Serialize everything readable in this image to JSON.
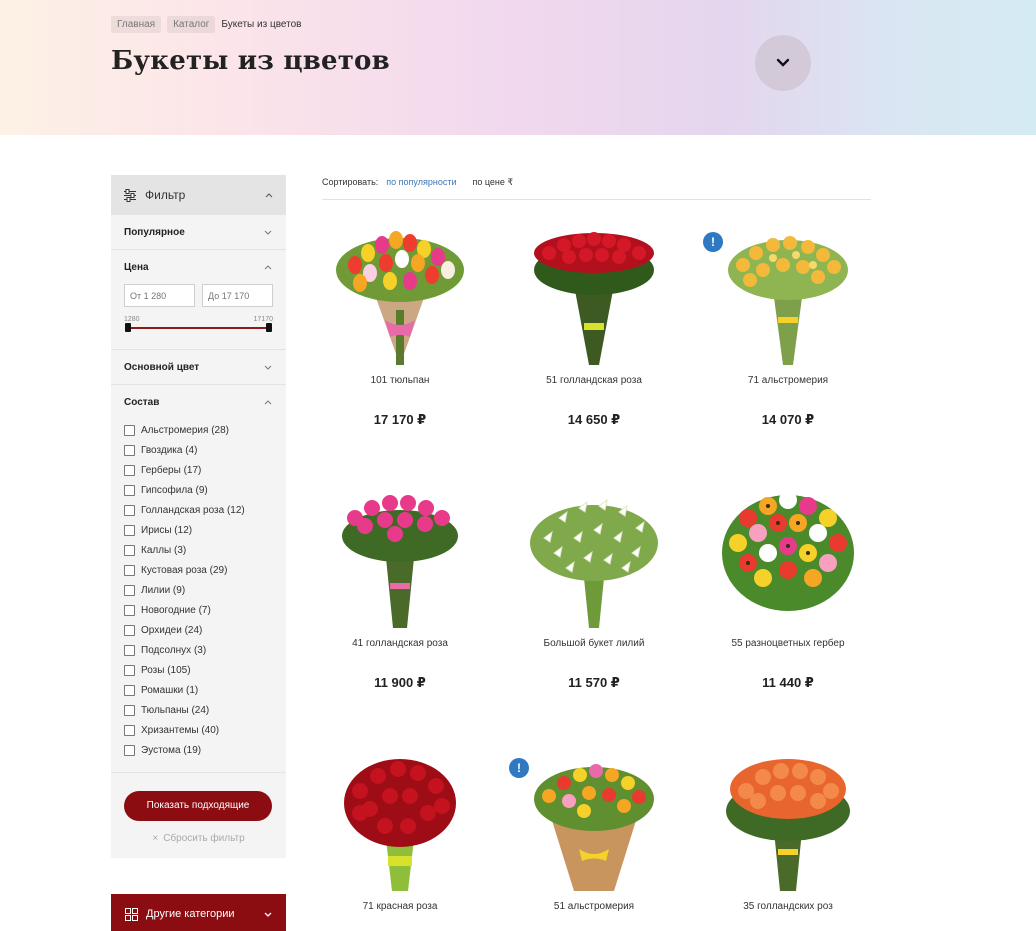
{
  "breadcrumb": [
    "Главная",
    "Каталог",
    "Букеты из цветов"
  ],
  "page_title": "Букеты из цветов",
  "sort": {
    "label": "Сортировать:",
    "popular": "по популярности",
    "price": "по цене ₹"
  },
  "filter": {
    "title": "Фильтр",
    "sections": {
      "popular": "Популярное",
      "price": "Цена",
      "color": "Основной цвет",
      "composition": "Состав"
    },
    "price_from": "От 1 280",
    "price_to": "До 17 170",
    "range_min": "1280",
    "range_max": "17170",
    "composition_items": [
      "Альстромерия (28)",
      "Гвоздика (4)",
      "Герберы (17)",
      "Гипсофила (9)",
      "Голландская роза (12)",
      "Ирисы (12)",
      "Каллы (3)",
      "Кустовая роза (29)",
      "Лилии (9)",
      "Новогодние (7)",
      "Орхидеи (24)",
      "Подсолнух (3)",
      "Розы (105)",
      "Ромашки (1)",
      "Тюльпаны (24)",
      "Хризантемы (40)",
      "Эустома (19)"
    ],
    "show_button": "Показать подходящие",
    "reset": "Сбросить фильтр"
  },
  "other_categories": "Другие категории",
  "products": [
    {
      "name": "101 тюльпан",
      "price": "17 170 ₽",
      "badge": ""
    },
    {
      "name": "51 голландская роза",
      "price": "14 650 ₽",
      "badge": ""
    },
    {
      "name": "71 альстромерия",
      "price": "14 070 ₽",
      "badge": "!"
    },
    {
      "name": "41 голландская роза",
      "price": "11 900 ₽",
      "badge": ""
    },
    {
      "name": "Большой букет лилий",
      "price": "11 570 ₽",
      "badge": ""
    },
    {
      "name": "55 разноцветных гербер",
      "price": "11 440 ₽",
      "badge": ""
    },
    {
      "name": "71 красная роза",
      "price": "",
      "badge": ""
    },
    {
      "name": "51 альстромерия",
      "price": "",
      "badge": "!"
    },
    {
      "name": "35 голландских роз",
      "price": "",
      "badge": ""
    }
  ],
  "colors": {
    "accent": "#8b0d12",
    "link": "#3d74b5",
    "badge": "#2e79c1"
  }
}
